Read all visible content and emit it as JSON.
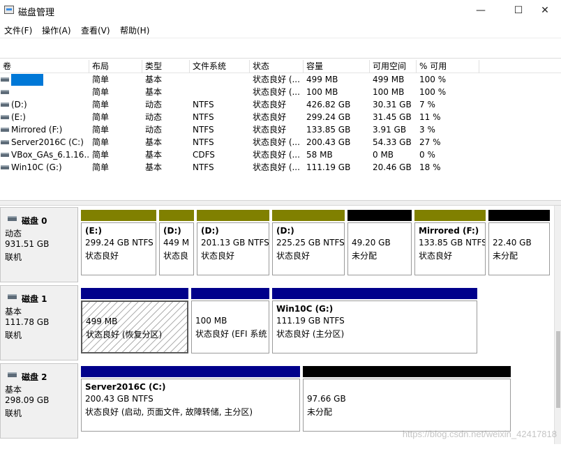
{
  "window": {
    "title": "磁盘管理",
    "min": "—",
    "max": "☐",
    "close": "✕"
  },
  "menu": [
    "文件(F)",
    "操作(A)",
    "查看(V)",
    "帮助(H)"
  ],
  "volume_table": {
    "headers": [
      "卷",
      "布局",
      "类型",
      "文件系统",
      "状态",
      "容量",
      "可用空间",
      "% 可用"
    ],
    "rows": [
      {
        "volume": "",
        "layout": "简单",
        "type": "基本",
        "fs": "",
        "status": "状态良好 (...",
        "capacity": "499 MB",
        "free": "499 MB",
        "pct": "100 %",
        "selected": true
      },
      {
        "volume": "",
        "layout": "简单",
        "type": "基本",
        "fs": "",
        "status": "状态良好 (...",
        "capacity": "100 MB",
        "free": "100 MB",
        "pct": "100 %"
      },
      {
        "volume": "(D:)",
        "layout": "简单",
        "type": "动态",
        "fs": "NTFS",
        "status": "状态良好",
        "capacity": "426.82 GB",
        "free": "30.31 GB",
        "pct": "7 %"
      },
      {
        "volume": "(E:)",
        "layout": "简单",
        "type": "动态",
        "fs": "NTFS",
        "status": "状态良好",
        "capacity": "299.24 GB",
        "free": "31.45 GB",
        "pct": "11 %"
      },
      {
        "volume": "Mirrored (F:)",
        "layout": "简单",
        "type": "动态",
        "fs": "NTFS",
        "status": "状态良好",
        "capacity": "133.85 GB",
        "free": "3.91 GB",
        "pct": "3 %"
      },
      {
        "volume": "Server2016C (C:)",
        "layout": "简单",
        "type": "基本",
        "fs": "NTFS",
        "status": "状态良好 (...",
        "capacity": "200.43 GB",
        "free": "54.33 GB",
        "pct": "27 %"
      },
      {
        "volume": "VBox_GAs_6.1.16...",
        "layout": "简单",
        "type": "基本",
        "fs": "CDFS",
        "status": "状态良好 (...",
        "capacity": "58 MB",
        "free": "0 MB",
        "pct": "0 %"
      },
      {
        "volume": "Win10C (G:)",
        "layout": "简单",
        "type": "基本",
        "fs": "NTFS",
        "status": "状态良好 (...",
        "capacity": "111.19 GB",
        "free": "20.46 GB",
        "pct": "18 %"
      }
    ]
  },
  "colors": {
    "dynamic": "#808000",
    "primary": "#00008b",
    "unallocated": "#000000",
    "selection": "#0078d7"
  },
  "disks": [
    {
      "title": "磁盘 0",
      "kind": "动态",
      "size": "931.51 GB",
      "state": "联机",
      "partitions": [
        {
          "name": "(E:)",
          "size_fs": "299.24 GB NTFS",
          "status": "状态良好",
          "bar": "dynamic"
        },
        {
          "name": "(D:)",
          "size_fs": "449 M",
          "status": "状态良",
          "bar": "dynamic"
        },
        {
          "name": "(D:)",
          "size_fs": "201.13 GB NTFS",
          "status": "状态良好",
          "bar": "dynamic"
        },
        {
          "name": "(D:)",
          "size_fs": "225.25 GB NTFS",
          "status": "状态良好",
          "bar": "dynamic"
        },
        {
          "name": "",
          "size_fs": "49.20 GB",
          "status": "未分配",
          "bar": "unallocated"
        },
        {
          "name": "Mirrored (F:)",
          "size_fs": "133.85 GB NTFS",
          "status": "状态良好",
          "bar": "dynamic"
        },
        {
          "name": "",
          "size_fs": "22.40 GB",
          "status": "未分配",
          "bar": "unallocated"
        }
      ]
    },
    {
      "title": "磁盘 1",
      "kind": "基本",
      "size": "111.78 GB",
      "state": "联机",
      "partitions": [
        {
          "name": "",
          "size_fs": "499 MB",
          "status": "状态良好 (恢复分区)",
          "bar": "primary",
          "selected": true
        },
        {
          "name": "",
          "size_fs": "100 MB",
          "status": "状态良好 (EFI 系统",
          "bar": "primary"
        },
        {
          "name": "Win10C (G:)",
          "size_fs": "111.19 GB NTFS",
          "status": "状态良好 (主分区)",
          "bar": "primary"
        }
      ]
    },
    {
      "title": "磁盘 2",
      "kind": "基本",
      "size": "298.09 GB",
      "state": "联机",
      "partitions": [
        {
          "name": "Server2016C (C:)",
          "size_fs": "200.43 GB NTFS",
          "status": "状态良好 (启动, 页面文件, 故障转储, 主分区)",
          "bar": "primary"
        },
        {
          "name": "",
          "size_fs": "97.66 GB",
          "status": "未分配",
          "bar": "unallocated"
        }
      ]
    }
  ],
  "watermark": "https://blog.csdn.net/weixin_42417818"
}
